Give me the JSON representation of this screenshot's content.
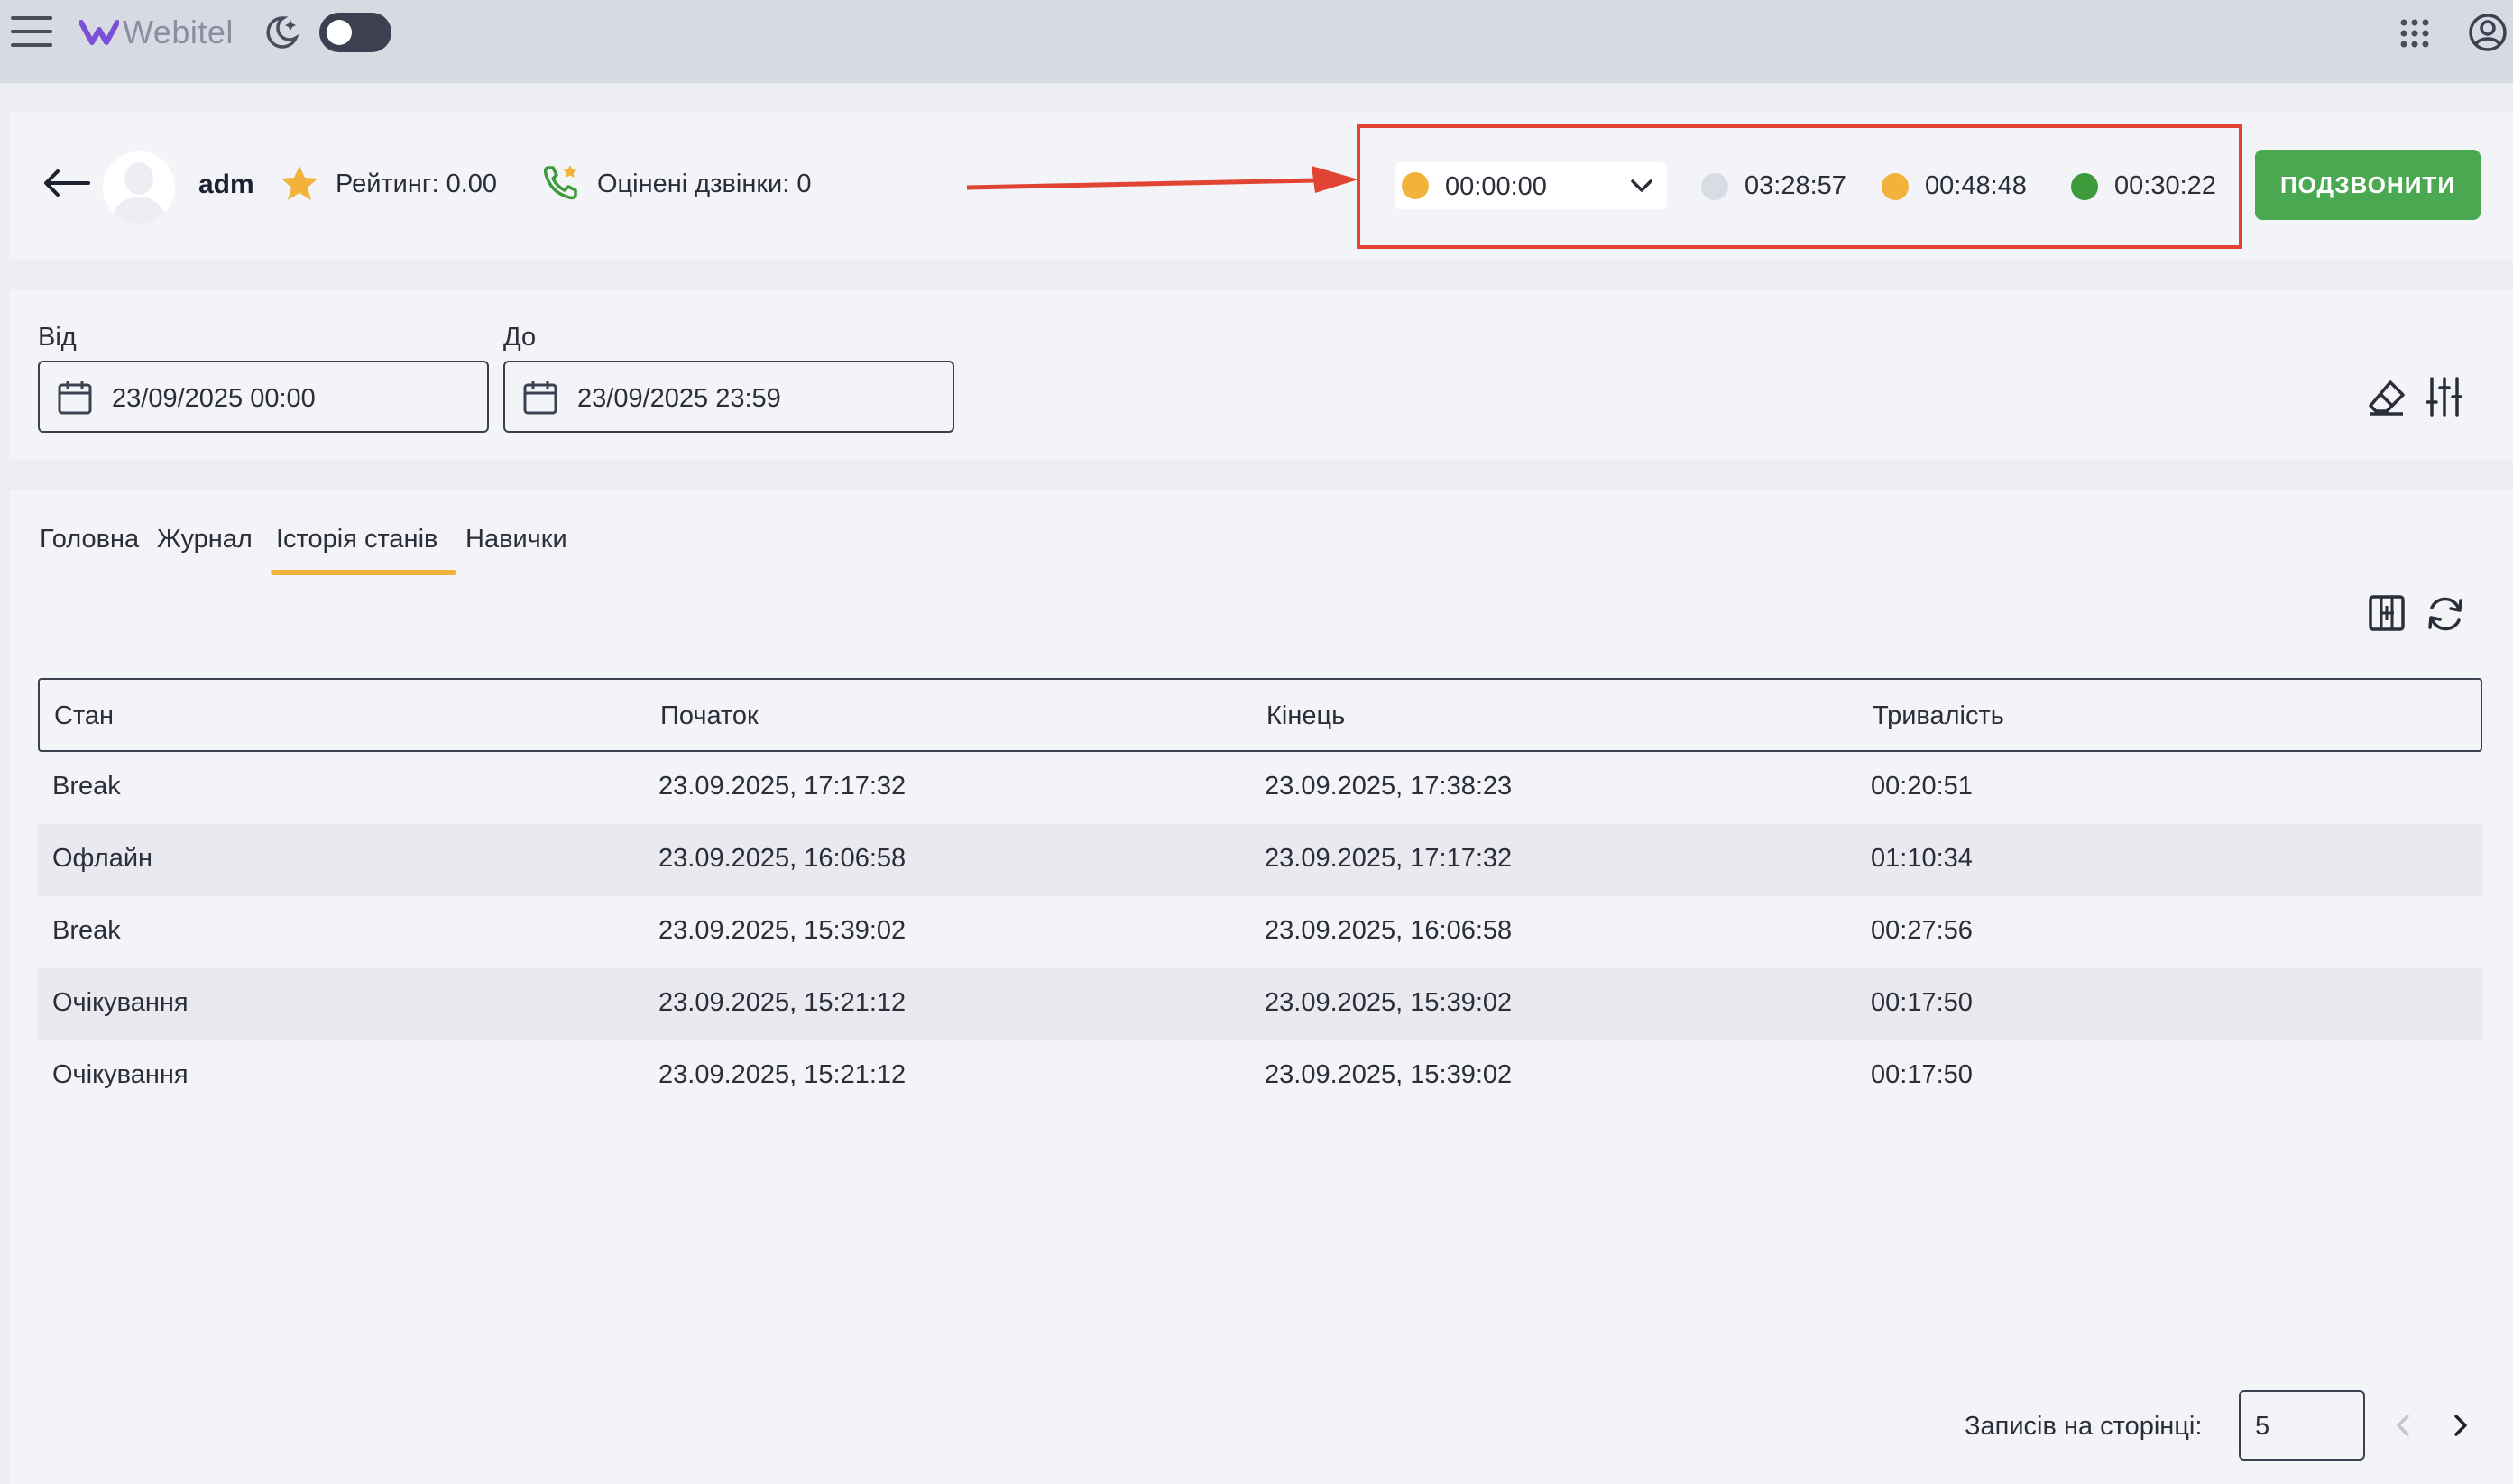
{
  "app": {
    "logo_text": "Webitel"
  },
  "header": {
    "username": "adm",
    "rating": "Рейтинг: 0.00",
    "rated_calls": "Оцінені дзвінки: 0",
    "status_select": {
      "value": "00:00:00",
      "color": "#f2b33c"
    },
    "stats": [
      {
        "time": "03:28:57",
        "color": "#d9dbe5"
      },
      {
        "time": "00:48:48",
        "color": "#f2b33c"
      },
      {
        "time": "00:30:22",
        "color": "#3d9a3a"
      }
    ],
    "call_button": "ПОДЗВОНИТИ",
    "call_button_color": "#4aa851",
    "annotation_color": "#e14432"
  },
  "filters": {
    "from_label": "Від",
    "from_value": "23/09/2025 00:00",
    "to_label": "До",
    "to_value": "23/09/2025 23:59"
  },
  "tabs": [
    {
      "label": "Головна",
      "active": false
    },
    {
      "label": "Журнал",
      "active": false
    },
    {
      "label": "Історія станів",
      "active": true
    },
    {
      "label": "Навички",
      "active": false
    }
  ],
  "table": {
    "headers": [
      "Стан",
      "Початок",
      "Кінець",
      "Тривалість"
    ],
    "rows": [
      [
        "Break",
        "23.09.2025, 17:17:32",
        "23.09.2025, 17:38:23",
        "00:20:51"
      ],
      [
        "Офлайн",
        "23.09.2025, 16:06:58",
        "23.09.2025, 17:17:32",
        "01:10:34"
      ],
      [
        "Break",
        "23.09.2025, 15:39:02",
        "23.09.2025, 16:06:58",
        "00:27:56"
      ],
      [
        "Очікування",
        "23.09.2025, 15:21:12",
        "23.09.2025, 15:39:02",
        "00:17:50"
      ],
      [
        "Очікування",
        "23.09.2025, 15:21:12",
        "23.09.2025, 15:39:02",
        "00:17:50"
      ]
    ]
  },
  "pagination": {
    "per_page_label": "Записів на сторінці:",
    "per_page_value": "5"
  },
  "icons": [
    "menu-icon",
    "moon-icon",
    "apps-grid-icon",
    "user-account-icon",
    "back-arrow-icon",
    "star-icon",
    "phone-star-icon",
    "chevron-down-icon",
    "calendar-icon",
    "eraser-icon",
    "sliders-icon",
    "columns-icon",
    "refresh-icon",
    "chevron-left-icon",
    "chevron-right-icon"
  ]
}
